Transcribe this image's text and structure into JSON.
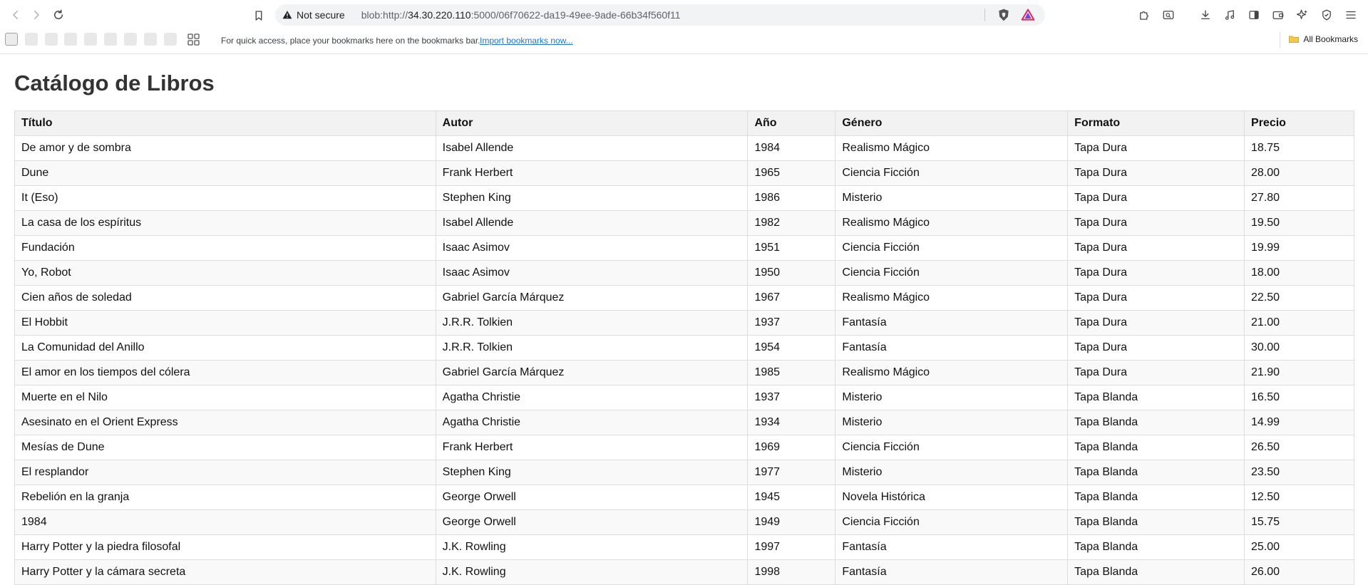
{
  "browser": {
    "security_label": "Not secure",
    "url_prefix": "blob:http://",
    "url_host": "34.30.220.110",
    "url_rest": ":5000/06f70622-da19-49ee-9ade-66b34f560f11",
    "bookmarks_hint": "For quick access, place your bookmarks here on the bookmarks bar.",
    "import_link": "Import bookmarks now...",
    "all_bookmarks": "All Bookmarks"
  },
  "page": {
    "title": "Catálogo de Libros"
  },
  "table": {
    "headers": [
      "Título",
      "Autor",
      "Año",
      "Género",
      "Formato",
      "Precio"
    ],
    "rows": [
      [
        "De amor y de sombra",
        "Isabel Allende",
        "1984",
        "Realismo Mágico",
        "Tapa Dura",
        "18.75"
      ],
      [
        "Dune",
        "Frank Herbert",
        "1965",
        "Ciencia Ficción",
        "Tapa Dura",
        "28.00"
      ],
      [
        "It (Eso)",
        "Stephen King",
        "1986",
        "Misterio",
        "Tapa Dura",
        "27.80"
      ],
      [
        "La casa de los espíritus",
        "Isabel Allende",
        "1982",
        "Realismo Mágico",
        "Tapa Dura",
        "19.50"
      ],
      [
        "Fundación",
        "Isaac Asimov",
        "1951",
        "Ciencia Ficción",
        "Tapa Dura",
        "19.99"
      ],
      [
        "Yo, Robot",
        "Isaac Asimov",
        "1950",
        "Ciencia Ficción",
        "Tapa Dura",
        "18.00"
      ],
      [
        "Cien años de soledad",
        "Gabriel García Márquez",
        "1967",
        "Realismo Mágico",
        "Tapa Dura",
        "22.50"
      ],
      [
        "El Hobbit",
        "J.R.R. Tolkien",
        "1937",
        "Fantasía",
        "Tapa Dura",
        "21.00"
      ],
      [
        "La Comunidad del Anillo",
        "J.R.R. Tolkien",
        "1954",
        "Fantasía",
        "Tapa Dura",
        "30.00"
      ],
      [
        "El amor en los tiempos del cólera",
        "Gabriel García Márquez",
        "1985",
        "Realismo Mágico",
        "Tapa Dura",
        "21.90"
      ],
      [
        "Muerte en el Nilo",
        "Agatha Christie",
        "1937",
        "Misterio",
        "Tapa Blanda",
        "16.50"
      ],
      [
        "Asesinato en el Orient Express",
        "Agatha Christie",
        "1934",
        "Misterio",
        "Tapa Blanda",
        "14.99"
      ],
      [
        "Mesías de Dune",
        "Frank Herbert",
        "1969",
        "Ciencia Ficción",
        "Tapa Blanda",
        "26.50"
      ],
      [
        "El resplandor",
        "Stephen King",
        "1977",
        "Misterio",
        "Tapa Blanda",
        "23.50"
      ],
      [
        "Rebelión en la granja",
        "George Orwell",
        "1945",
        "Novela Histórica",
        "Tapa Blanda",
        "12.50"
      ],
      [
        "1984",
        "George Orwell",
        "1949",
        "Ciencia Ficción",
        "Tapa Blanda",
        "15.75"
      ],
      [
        "Harry Potter y la piedra filosofal",
        "J.K. Rowling",
        "1997",
        "Fantasía",
        "Tapa Blanda",
        "25.00"
      ],
      [
        "Harry Potter y la cámara secreta",
        "J.K. Rowling",
        "1998",
        "Fantasía",
        "Tapa Blanda",
        "26.00"
      ]
    ]
  }
}
